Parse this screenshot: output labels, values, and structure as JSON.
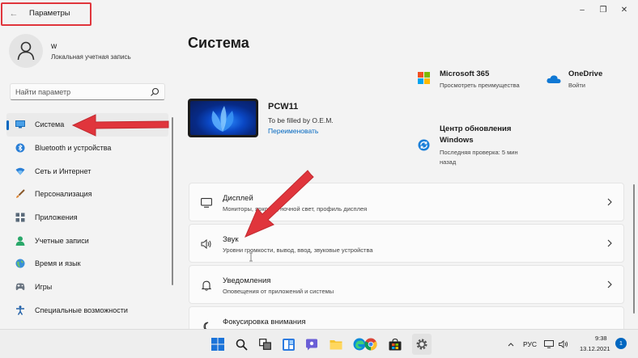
{
  "window": {
    "title": "Параметры",
    "back_glyph": "←",
    "minimize_glyph": "–",
    "maximize_glyph": "❐",
    "close_glyph": "✕"
  },
  "profile": {
    "name": "w",
    "account_type": "Локальная учетная запись"
  },
  "search": {
    "placeholder": "Найти параметр"
  },
  "sidebar": {
    "items": [
      {
        "label": "Система",
        "icon": "monitor-icon",
        "active": true
      },
      {
        "label": "Bluetooth и устройства",
        "icon": "bluetooth-icon"
      },
      {
        "label": "Сеть и Интернет",
        "icon": "wifi-icon"
      },
      {
        "label": "Персонализация",
        "icon": "brush-icon"
      },
      {
        "label": "Приложения",
        "icon": "apps-icon"
      },
      {
        "label": "Учетные записи",
        "icon": "accounts-icon"
      },
      {
        "label": "Время и язык",
        "icon": "globe-icon"
      },
      {
        "label": "Игры",
        "icon": "gamepad-icon"
      },
      {
        "label": "Специальные возможности",
        "icon": "accessibility-icon"
      }
    ]
  },
  "main": {
    "title": "Система",
    "device": {
      "name": "PCW11",
      "model": "To be filled by O.E.M.",
      "rename": "Переименовать"
    },
    "cards": {
      "m365": {
        "title": "Microsoft 365",
        "sub": "Просмотреть преимущества"
      },
      "onedrive": {
        "title": "OneDrive",
        "sub": "Войти"
      },
      "update": {
        "title_line1": "Центр обновления",
        "title_line2": "Windows",
        "sub_line1": "Последняя проверка: 5 мин",
        "sub_line2": "назад"
      }
    },
    "settings": [
      {
        "title": "Дисплей",
        "sub": "Мониторы, яркость, ночной свет, профиль дисплея"
      },
      {
        "title": "Звук",
        "sub": "Уровни громкости, вывод, ввод, звуковые устройства"
      },
      {
        "title": "Уведомления",
        "sub": "Оповещения от приложений и системы"
      },
      {
        "title": "Фокусировка внимания",
        "sub": ""
      }
    ]
  },
  "taskbar": {
    "language": "РУС",
    "time": "9:38",
    "date": "13.12.2021",
    "notifications": "1"
  },
  "colors": {
    "accent": "#0067c0",
    "annotation_red": "#e0353c"
  }
}
